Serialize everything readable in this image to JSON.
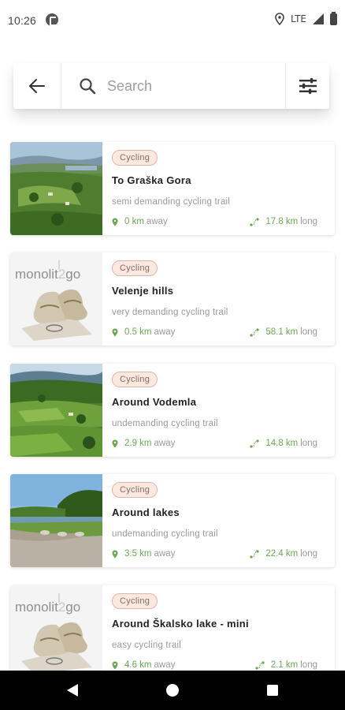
{
  "status_bar": {
    "time": "10:26",
    "network": "LTE",
    "icons": [
      "app-icon",
      "location-icon",
      "signal-icon",
      "battery-icon"
    ]
  },
  "search": {
    "placeholder": "Search",
    "value": "",
    "icons": {
      "back": "arrow-left-icon",
      "search": "search-icon",
      "filter": "filter-sliders-icon"
    }
  },
  "trails": [
    {
      "category": "Cycling",
      "title": "To Graška Gora",
      "description": "semi demanding cycling trail",
      "distance": "0 km",
      "distance_suffix": "away",
      "length": "17.8 km",
      "length_suffix": "long",
      "thumbnail": "landscape-photo"
    },
    {
      "category": "Cycling",
      "title": "Velenje hills",
      "description": "very demanding cycling trail",
      "distance": "0.5 km",
      "distance_suffix": "away",
      "length": "58.1 km",
      "length_suffix": "long",
      "thumbnail": "monolit2go-logo"
    },
    {
      "category": "Cycling",
      "title": "Around Vodemla",
      "description": "undemanding cycling trail",
      "distance": "2.9 km",
      "distance_suffix": "away",
      "length": "14.8 km",
      "length_suffix": "long",
      "thumbnail": "landscape-photo"
    },
    {
      "category": "Cycling",
      "title": "Around lakes",
      "description": "undemanding cycling trail",
      "distance": "3.5 km",
      "distance_suffix": "away",
      "length": "22.4 km",
      "length_suffix": "long",
      "thumbnail": "lake-photo"
    },
    {
      "category": "Cycling",
      "title": "Around Škalsko lake - mini",
      "description": "easy cycling trail",
      "distance": "4.6 km",
      "distance_suffix": "away",
      "length": "2.1 km",
      "length_suffix": "long",
      "thumbnail": "monolit2go-logo"
    }
  ],
  "placeholder_logo": {
    "text": "monolit",
    "highlight": "2",
    "text_end": "go"
  },
  "colors": {
    "accent_green": "#6aa84f",
    "badge_bg": "#fbe8e1",
    "badge_border": "#e2b6a8",
    "badge_text": "#8a6b60",
    "muted_text": "#9a9a9a"
  },
  "nav_bar": {
    "icons": [
      "back-triangle-icon",
      "home-circle-icon",
      "recents-square-icon"
    ]
  }
}
